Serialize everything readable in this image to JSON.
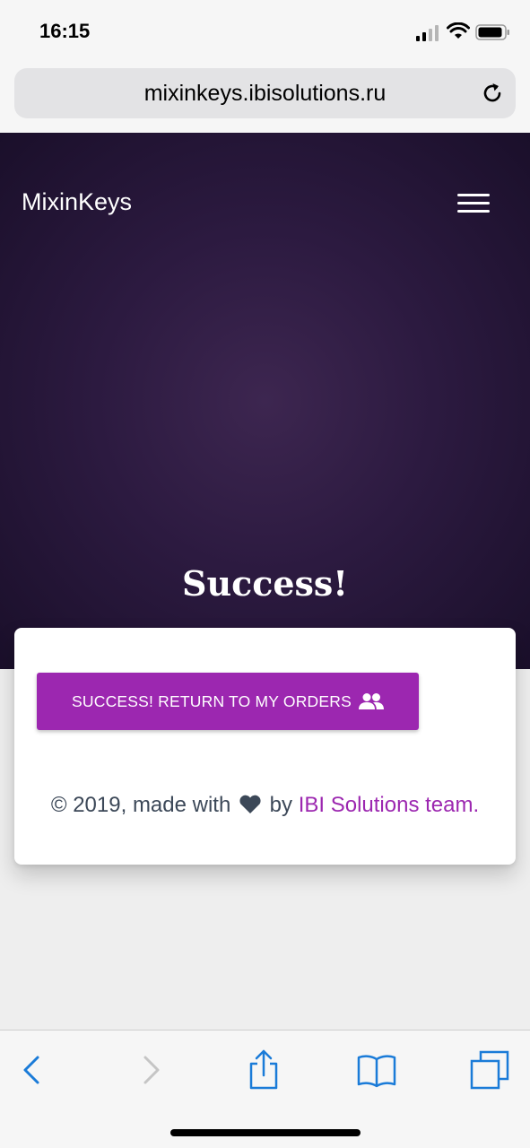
{
  "status_bar": {
    "time": "16:15",
    "icons": [
      "signal-icon",
      "wifi-icon",
      "battery-icon"
    ]
  },
  "browser": {
    "url": "mixinkeys.ibisolutions.ru",
    "reload_icon": "reload-icon",
    "toolbar": [
      "back-icon",
      "forward-icon",
      "share-icon",
      "bookmarks-icon",
      "tabs-icon"
    ]
  },
  "navbar": {
    "brand": "MixinKeys",
    "menu_icon": "hamburger-menu-icon"
  },
  "hero": {
    "title": "Success!"
  },
  "card": {
    "return_button_label": "SUCCESS! RETURN TO MY ORDERS",
    "return_button_icon": "people-icon",
    "footer_prefix": "© 2019, made with",
    "footer_heart_icon": "heart-icon",
    "footer_by": "by",
    "footer_link": "IBI Solutions team."
  },
  "colors": {
    "accent": "#9c27b0",
    "hero_dark": "#1a0f2a",
    "hero_center": "#3d2650",
    "footer_text": "#3c4858",
    "ios_blue": "#1a7bd8"
  }
}
